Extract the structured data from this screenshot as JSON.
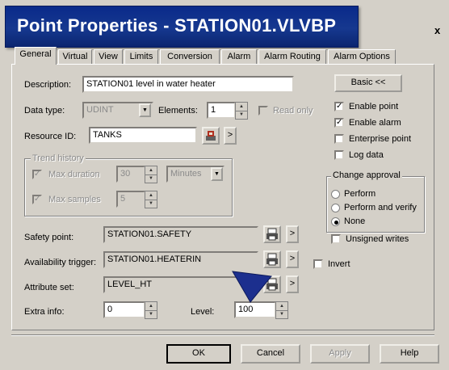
{
  "window": {
    "title": "Point Properties - STATION01.VLVBP",
    "close": "x"
  },
  "tabs": [
    "General",
    "Virtual",
    "View",
    "Limits",
    "Conversion",
    "Alarm",
    "Alarm Routing",
    "Alarm Options"
  ],
  "general": {
    "description_label": "Description:",
    "description_value": "STATION01 level in water heater",
    "datatype_label": "Data type:",
    "datatype_value": "UDINT",
    "elements_label": "Elements:",
    "elements_value": "1",
    "readonly_label": "Read only",
    "resource_label": "Resource ID:",
    "resource_value": "TANKS",
    "basic_button": "Basic <<",
    "enable_point": "Enable point",
    "enable_alarm": "Enable alarm",
    "enterprise_point": "Enterprise point",
    "log_data": "Log data",
    "check_mark": "✓",
    "trend_title": "Trend history",
    "max_duration_label": "Max duration",
    "max_duration_value": "30",
    "minutes_value": "Minutes",
    "max_samples_label": "Max samples",
    "max_samples_value": "5",
    "change_approval_title": "Change approval",
    "perform": "Perform",
    "perform_verify": "Perform and verify",
    "none": "None",
    "unsigned_writes": "Unsigned writes",
    "safety_label": "Safety point:",
    "safety_value": "STATION01.SAFETY",
    "availability_label": "Availability trigger:",
    "availability_value": "STATION01.HEATERIN",
    "invert_label": "Invert",
    "attribute_label": "Attribute set:",
    "attribute_value": "LEVEL_HT",
    "extra_label": "Extra info:",
    "extra_value": "0",
    "level_label": "Level:",
    "level_value": "100",
    "arrow": ">"
  },
  "buttons": {
    "ok": "OK",
    "cancel": "Cancel",
    "apply": "Apply",
    "help": "Help"
  }
}
